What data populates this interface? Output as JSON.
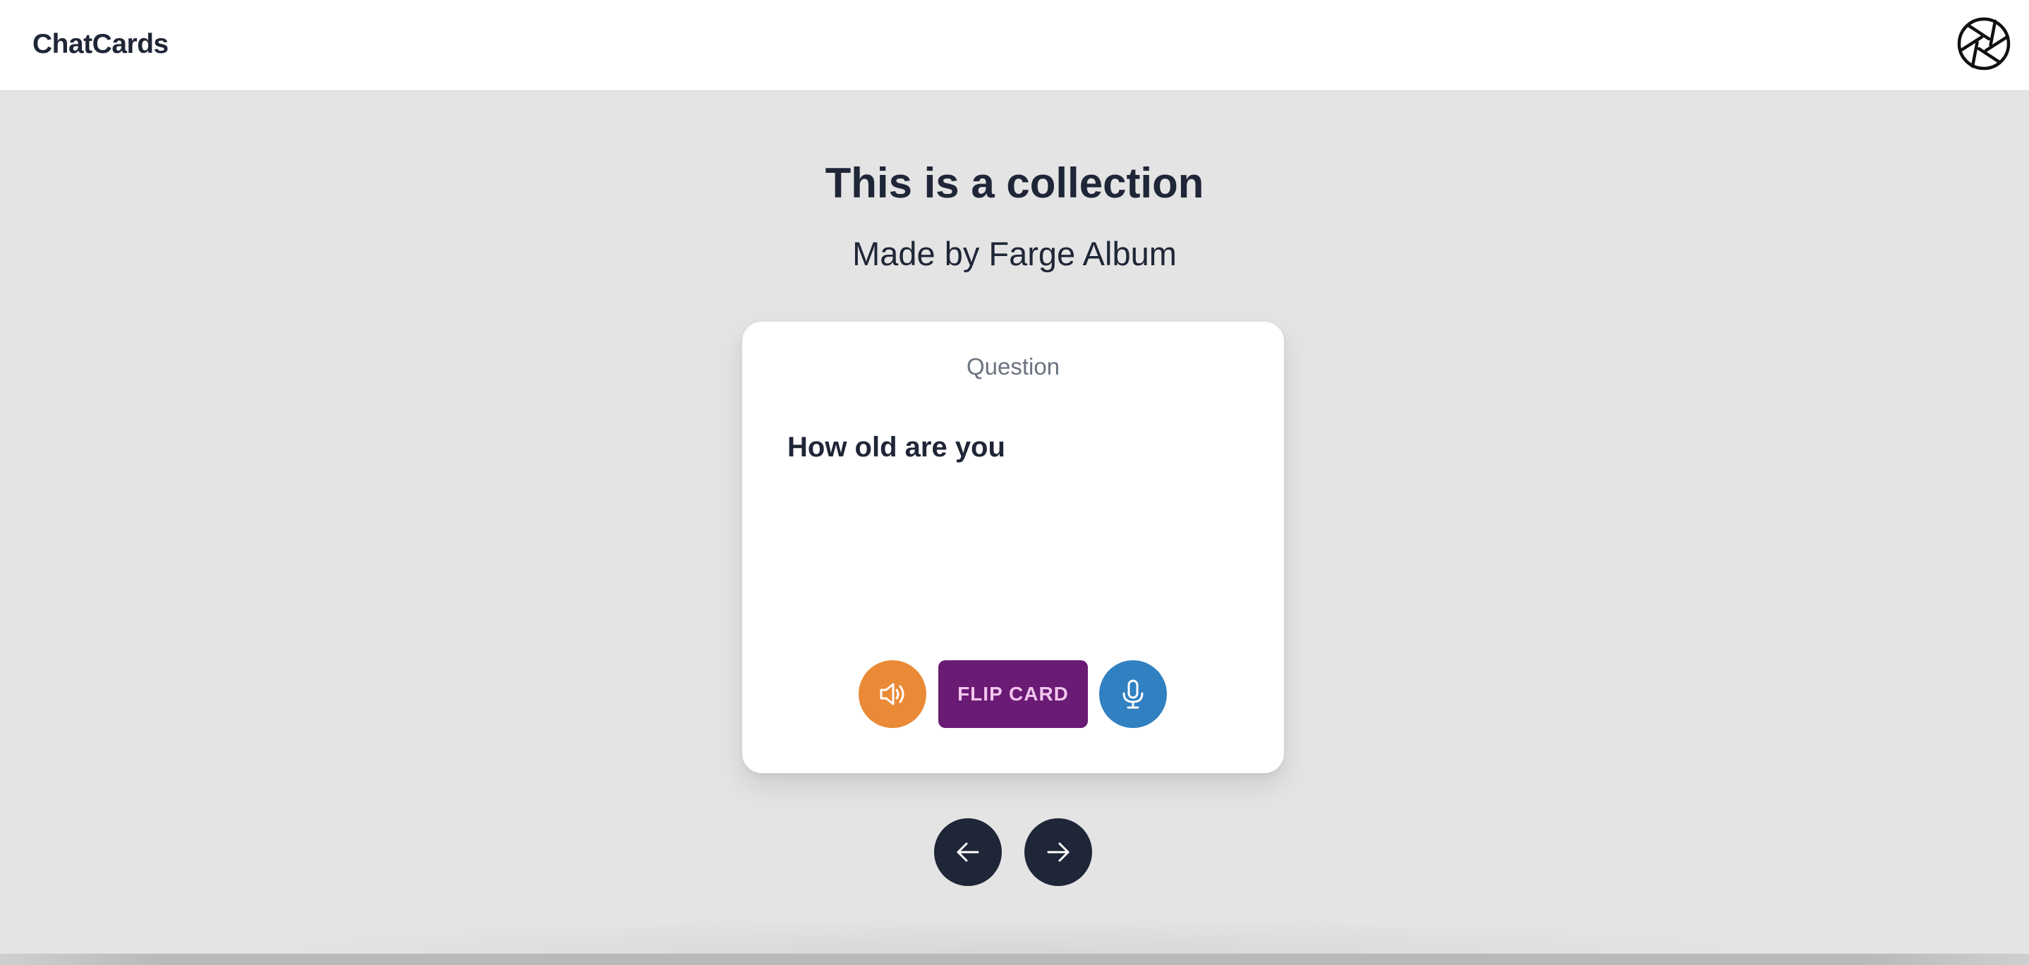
{
  "header": {
    "brand": "ChatCards",
    "logo_icon": "aperture-icon"
  },
  "collection": {
    "title": "This is a collection",
    "subtitle": "Made by Farge Album"
  },
  "card": {
    "side_label": "Question",
    "text": "How old are you",
    "speak_icon": "speaker-icon",
    "flip_label": "FLIP CARD",
    "mic_icon": "microphone-icon"
  },
  "navigation": {
    "prev_icon": "arrow-left-icon",
    "next_icon": "arrow-right-icon"
  },
  "colors": {
    "background": "#e4e4e5",
    "text": "#1f2637",
    "speak_button": "#ea8a36",
    "flip_button": "#6a1b74",
    "flip_text": "#f3c7f0",
    "mic_button": "#3180c1",
    "nav_button": "#1f2637"
  }
}
